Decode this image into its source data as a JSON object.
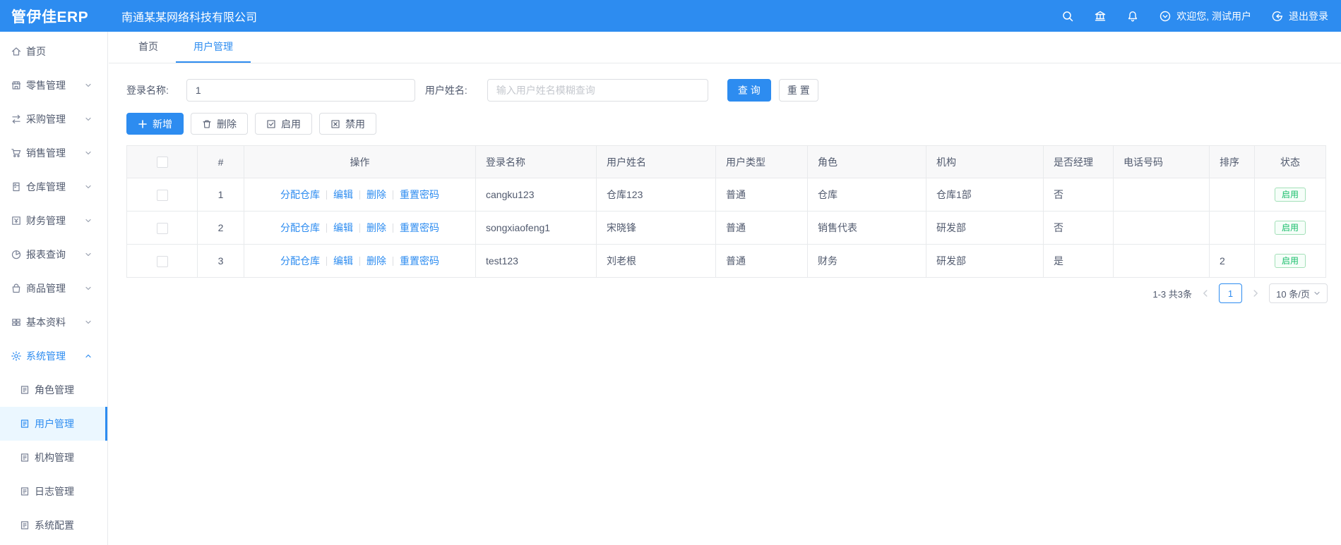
{
  "header": {
    "logo": "管伊佳ERP",
    "company": "南通某某网络科技有限公司",
    "welcome": "欢迎您, 测试用户",
    "logout": "退出登录",
    "icons": [
      "search-icon",
      "bank-icon",
      "bell-icon",
      "circle-chevron-down-icon",
      "logout-icon"
    ]
  },
  "tabs": [
    {
      "label": "首页"
    },
    {
      "label": "用户管理"
    }
  ],
  "sidebar": {
    "items": [
      {
        "label": "首页",
        "icon": "home-icon"
      },
      {
        "label": "零售管理",
        "icon": "retail-icon"
      },
      {
        "label": "采购管理",
        "icon": "purchase-icon"
      },
      {
        "label": "销售管理",
        "icon": "cart-icon"
      },
      {
        "label": "仓库管理",
        "icon": "warehouse-icon"
      },
      {
        "label": "财务管理",
        "icon": "finance-icon"
      },
      {
        "label": "报表查询",
        "icon": "pie-chart-icon"
      },
      {
        "label": "商品管理",
        "icon": "bag-icon"
      },
      {
        "label": "基本资料",
        "icon": "grid-icon"
      },
      {
        "label": "系统管理",
        "icon": "gear-icon"
      }
    ],
    "sub_items": [
      {
        "label": "角色管理"
      },
      {
        "label": "用户管理"
      },
      {
        "label": "机构管理"
      },
      {
        "label": "日志管理"
      },
      {
        "label": "系统配置"
      }
    ]
  },
  "search": {
    "login_label": "登录名称:",
    "login_value": "1",
    "name_label": "用户姓名:",
    "name_placeholder": "输入用户姓名模糊查询",
    "query_button": "查 询",
    "reset_button": "重 置"
  },
  "toolbar": {
    "add": "新增",
    "delete": "删除",
    "enable": "启用",
    "disable": "禁用"
  },
  "table": {
    "headers": [
      "#",
      "操作",
      "登录名称",
      "用户姓名",
      "用户类型",
      "角色",
      "机构",
      "是否经理",
      "电话号码",
      "排序",
      "状态"
    ],
    "action_links": [
      "分配仓库",
      "编辑",
      "删除",
      "重置密码"
    ],
    "rows": [
      {
        "index": "1",
        "login": "cangku123",
        "name": "仓库123",
        "type": "普通",
        "role": "仓库",
        "org": "仓库1部",
        "manager": "否",
        "phone": "",
        "sort": "",
        "status": "启用"
      },
      {
        "index": "2",
        "login": "songxiaofeng1",
        "name": "宋晓锋",
        "type": "普通",
        "role": "销售代表",
        "org": "研发部",
        "manager": "否",
        "phone": "",
        "sort": "",
        "status": "启用"
      },
      {
        "index": "3",
        "login": "test123",
        "name": "刘老根",
        "type": "普通",
        "role": "财务",
        "org": "研发部",
        "manager": "是",
        "phone": "",
        "sort": "2",
        "status": "启用"
      }
    ]
  },
  "pagination": {
    "total": "1-3 共3条",
    "page": "1",
    "page_size": "10 条/页"
  },
  "colors": {
    "primary": "#2d8cf0",
    "success": "#19be6b",
    "border": "#e8eaec",
    "table_header_bg": "#f8f8f9",
    "text": "#515a6e"
  }
}
